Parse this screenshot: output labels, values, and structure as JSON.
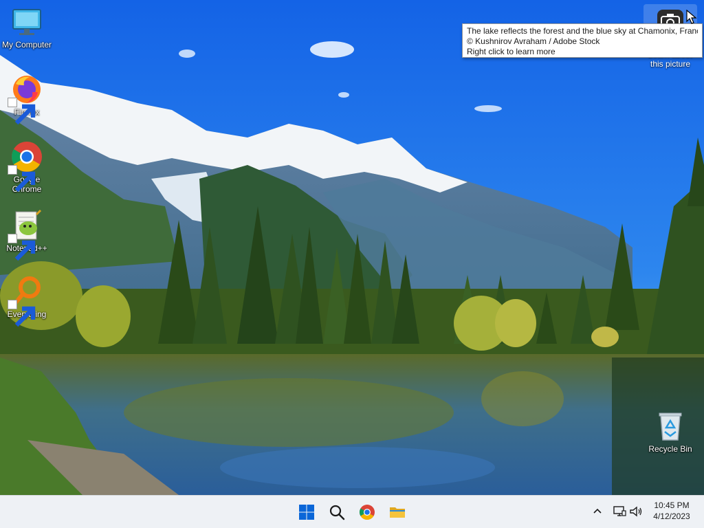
{
  "desktop": {
    "icons": [
      {
        "label": "My Computer",
        "icon": "monitor-icon"
      },
      {
        "label": "Firefox",
        "icon": "firefox-icon"
      },
      {
        "label": "Google Chrome",
        "icon": "chrome-icon"
      },
      {
        "label": "Notepad++",
        "icon": "notepad-plus-plus-icon"
      },
      {
        "label": "Everything",
        "icon": "everything-search-icon"
      },
      {
        "label": "Recycle Bin",
        "icon": "recycle-bin-icon"
      }
    ]
  },
  "spotlight": {
    "label": "Learn about this picture",
    "icon": "camera-icon"
  },
  "tooltip": {
    "line1": "The lake reflects the forest and the blue sky at Chamonix, France",
    "line2": "© Kushnirov Avraham / Adobe Stock",
    "line3": "Right click to learn more"
  },
  "taskbar": {
    "buttons": [
      {
        "name": "start",
        "icon": "windows-logo-icon"
      },
      {
        "name": "search",
        "icon": "search-icon"
      },
      {
        "name": "chrome",
        "icon": "chrome-icon"
      },
      {
        "name": "file-explorer",
        "icon": "folder-icon"
      }
    ],
    "tray": {
      "icons": [
        "chevron-up-icon",
        "network-icon",
        "speaker-icon"
      ],
      "time": "10:45 PM",
      "date": "4/12/2023"
    }
  },
  "colors": {
    "sky_top": "#1565e8",
    "sky_horizon": "#5aa8f0",
    "taskbar_bg": "#eef1f5",
    "windows_blue": "#0a66d8",
    "folder_yellow": "#f5c33b"
  }
}
